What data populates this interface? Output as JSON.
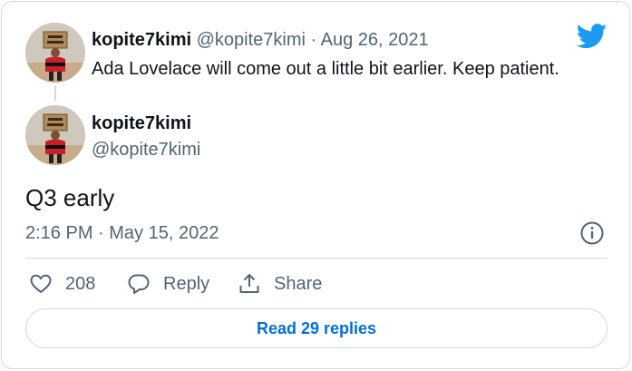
{
  "quoted_tweet": {
    "display_name": "kopite7kimi",
    "handle": "@kopite7kimi",
    "separator": "·",
    "date": "Aug 26, 2021",
    "text": "Ada Lovelace will come out a little bit earlier. Keep patient."
  },
  "main_tweet": {
    "display_name": "kopite7kimi",
    "handle": "@kopite7kimi",
    "text": "Q3 early",
    "timestamp": "2:16 PM · May 15, 2022"
  },
  "actions": {
    "like_count": "208",
    "reply_label": "Reply",
    "share_label": "Share"
  },
  "read_replies_label": "Read 29 replies",
  "icons": {
    "brand": "twitter-bird-icon",
    "info": "info-icon",
    "like": "heart-icon",
    "reply": "speech-bubble-icon",
    "share": "share-upload-icon"
  },
  "colors": {
    "twitter_blue": "#1d9bf0",
    "link_blue": "#006fd6",
    "secondary_text": "#536471",
    "border": "#cfd9de"
  }
}
